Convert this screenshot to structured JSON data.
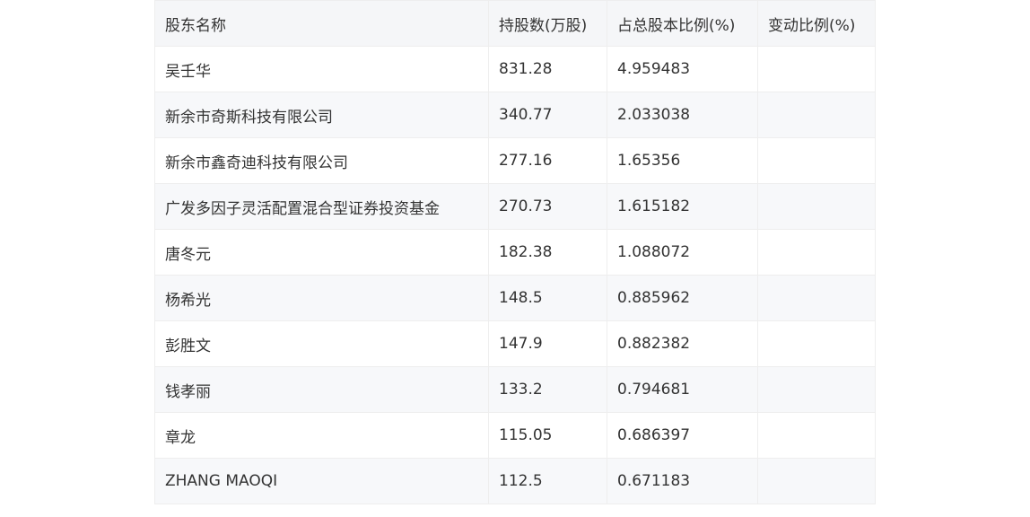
{
  "table": {
    "headers": [
      "股东名称",
      "持股数(万股)",
      "占总股本比例(%)",
      "变动比例(%)"
    ],
    "rows": [
      {
        "name": "吴壬华",
        "shares": "831.28",
        "ratio": "4.959483",
        "change": ""
      },
      {
        "name": "新余市奇斯科技有限公司",
        "shares": "340.77",
        "ratio": "2.033038",
        "change": ""
      },
      {
        "name": "新余市鑫奇迪科技有限公司",
        "shares": "277.16",
        "ratio": "1.65356",
        "change": ""
      },
      {
        "name": "广发多因子灵活配置混合型证券投资基金",
        "shares": "270.73",
        "ratio": "1.615182",
        "change": ""
      },
      {
        "name": "唐冬元",
        "shares": "182.38",
        "ratio": "1.088072",
        "change": ""
      },
      {
        "name": "杨希光",
        "shares": "148.5",
        "ratio": "0.885962",
        "change": ""
      },
      {
        "name": "彭胜文",
        "shares": "147.9",
        "ratio": "0.882382",
        "change": ""
      },
      {
        "name": "钱孝丽",
        "shares": "133.2",
        "ratio": "0.794681",
        "change": ""
      },
      {
        "name": "章龙",
        "shares": "115.05",
        "ratio": "0.686397",
        "change": ""
      },
      {
        "name": "ZHANG MAOQI",
        "shares": "112.5",
        "ratio": "0.671183",
        "change": ""
      }
    ]
  }
}
